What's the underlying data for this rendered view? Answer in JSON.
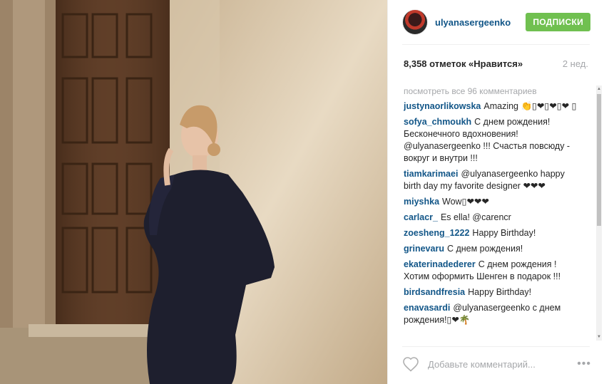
{
  "post": {
    "photo_alt": "",
    "user": {
      "username": "ulyanasergeenko",
      "follow_label": "Подписки"
    },
    "likes": "8,358 отметок «Нравится»",
    "time": "2 нед.",
    "view_all": "посмотреть все 96 комментариев",
    "comments": [
      {
        "user": "justynaorlikowska",
        "text": "Amazing 👏▯❤▯❤▯❤ ▯"
      },
      {
        "user": "sofya_chmoukh",
        "text": "С днем рождения! Бесконечного вдохновения! @ulyanasergeenko !!! Счастья повсюду - вокруг и внутри !!!"
      },
      {
        "user": "tiamkarimaei",
        "text": "@ulyanasergeenko happy birth day my favorite designer ❤❤❤"
      },
      {
        "user": "miyshka",
        "text": "Wow▯❤❤❤"
      },
      {
        "user": "carlacr_",
        "text": "Es ella! @carencr"
      },
      {
        "user": "zoesheng_1222",
        "text": "Happy Birthday!"
      },
      {
        "user": "grinevaru",
        "text": "С днем рождения!"
      },
      {
        "user": "ekaterinadederer",
        "text": "С днем рождения ! Хотим оформить Шенген в подарок !!!"
      },
      {
        "user": "birdsandfresia",
        "text": "Happy Birthday!"
      },
      {
        "user": "enavasardi",
        "text": "@ulyanasergeenko с днем рождения!▯❤🌴"
      }
    ],
    "add_comment_placeholder": "Добавьте комментарий...",
    "more_label": "•••"
  },
  "icons": {
    "heart": "heart-icon",
    "more": "more-options-icon"
  },
  "colors": {
    "link": "#125688",
    "follow": "#70c050",
    "muted": "#a5a7aa"
  }
}
